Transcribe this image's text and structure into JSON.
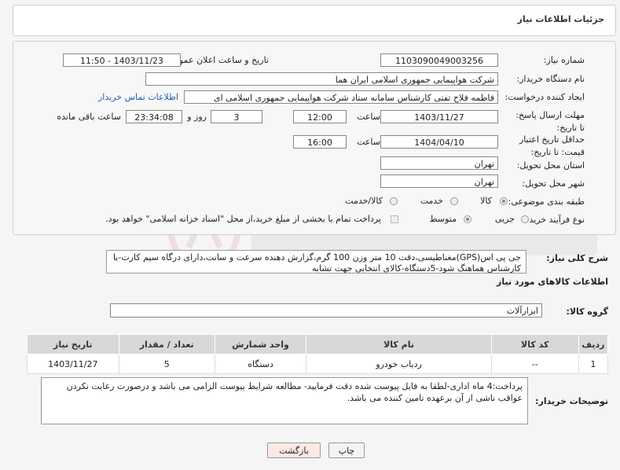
{
  "header": {
    "title": "جزئیات اطلاعات نیاز"
  },
  "form": {
    "need_number_label": "شماره نیاز:",
    "need_number": "1103090049003256",
    "announce_label": "تاریخ و ساعت اعلان عمومی:",
    "announce_value": "1403/11/23 - 11:50",
    "buyer_org_label": "نام دستگاه خریدار:",
    "buyer_org": "شرکت هواپیمایی جمهوری اسلامی ایران هما",
    "creator_label": "ایجاد کننده درخواست:",
    "creator": "فاطمه فلاح تفتی کارشناس سامانه ستاد شرکت هواپیمایی جمهوری اسلامی ای",
    "contact_link": "اطلاعات تماس خریدار",
    "reply_deadline_label": "مهلت ارسال پاسخ: تا تاریخ:",
    "reply_date": "1403/11/27",
    "time_label": "ساعت",
    "reply_time": "12:00",
    "days_value": "3",
    "days_label": "روز و",
    "remaining_time": "23:34:08",
    "remaining_label": "ساعت باقی مانده",
    "price_validity_label": "حداقل تاریخ اعتبار قیمت: تا تاریخ:",
    "validity_date": "1404/04/10",
    "validity_time": "16:00",
    "province_label": "استان محل تحویل:",
    "province": "تهران",
    "city_label": "شهر محل تحویل:",
    "city": "تهران",
    "category_label": "طبقه بندی موضوعی:",
    "category_options": [
      "کالا",
      "خدمت",
      "کالا/خدمت"
    ],
    "purchase_type_label": "نوع فرآیند خرید :",
    "purchase_options": [
      "جزیی",
      "متوسط"
    ],
    "treasury_note": "پرداخت تمام یا بخشی از مبلغ خرید،از محل \"اسناد خزانه اسلامی\" خواهد بود."
  },
  "summary": {
    "label": "شرح کلی نیاز:",
    "text": "جی پی اس(GPS)مغناطیسی،دقت 10 متر وزن 100 گرم،گزارش دهنده سرعت و سانت،دارای درگاه سیم کارت-با کارشناس هماهنگ شود-5دستگاه-کالای انتخابی جهت تشابه"
  },
  "goods": {
    "section_title": "اطلاعات کالاهای مورد نیاز",
    "group_label": "گروه کالا:",
    "group_value": "ابزارآلات",
    "columns": [
      "ردیف",
      "کد کالا",
      "نام کالا",
      "واحد شمارش",
      "تعداد / مقدار",
      "تاریخ نیاز"
    ],
    "rows": [
      [
        "1",
        "--",
        "ردیاب خودرو",
        "دستگاه",
        "5",
        "1403/11/27"
      ]
    ]
  },
  "notes": {
    "label": "توضیحات خریدار:",
    "text": "پرداخت:4 ماه اداری-لطفا به فایل پیوست شده دقت فرمایید- مطالعه شرایط پیوست الزامی می باشد و درصورت رعایت نکردن عواقب ناشی از آن برعهده تامین کننده می باشد."
  },
  "buttons": {
    "print": "چاپ",
    "back": "بازگشت"
  },
  "colors": {
    "link": "#1a5fb4",
    "back_button_bg": "#fde8e8",
    "table_header": "#d8d8d8"
  }
}
